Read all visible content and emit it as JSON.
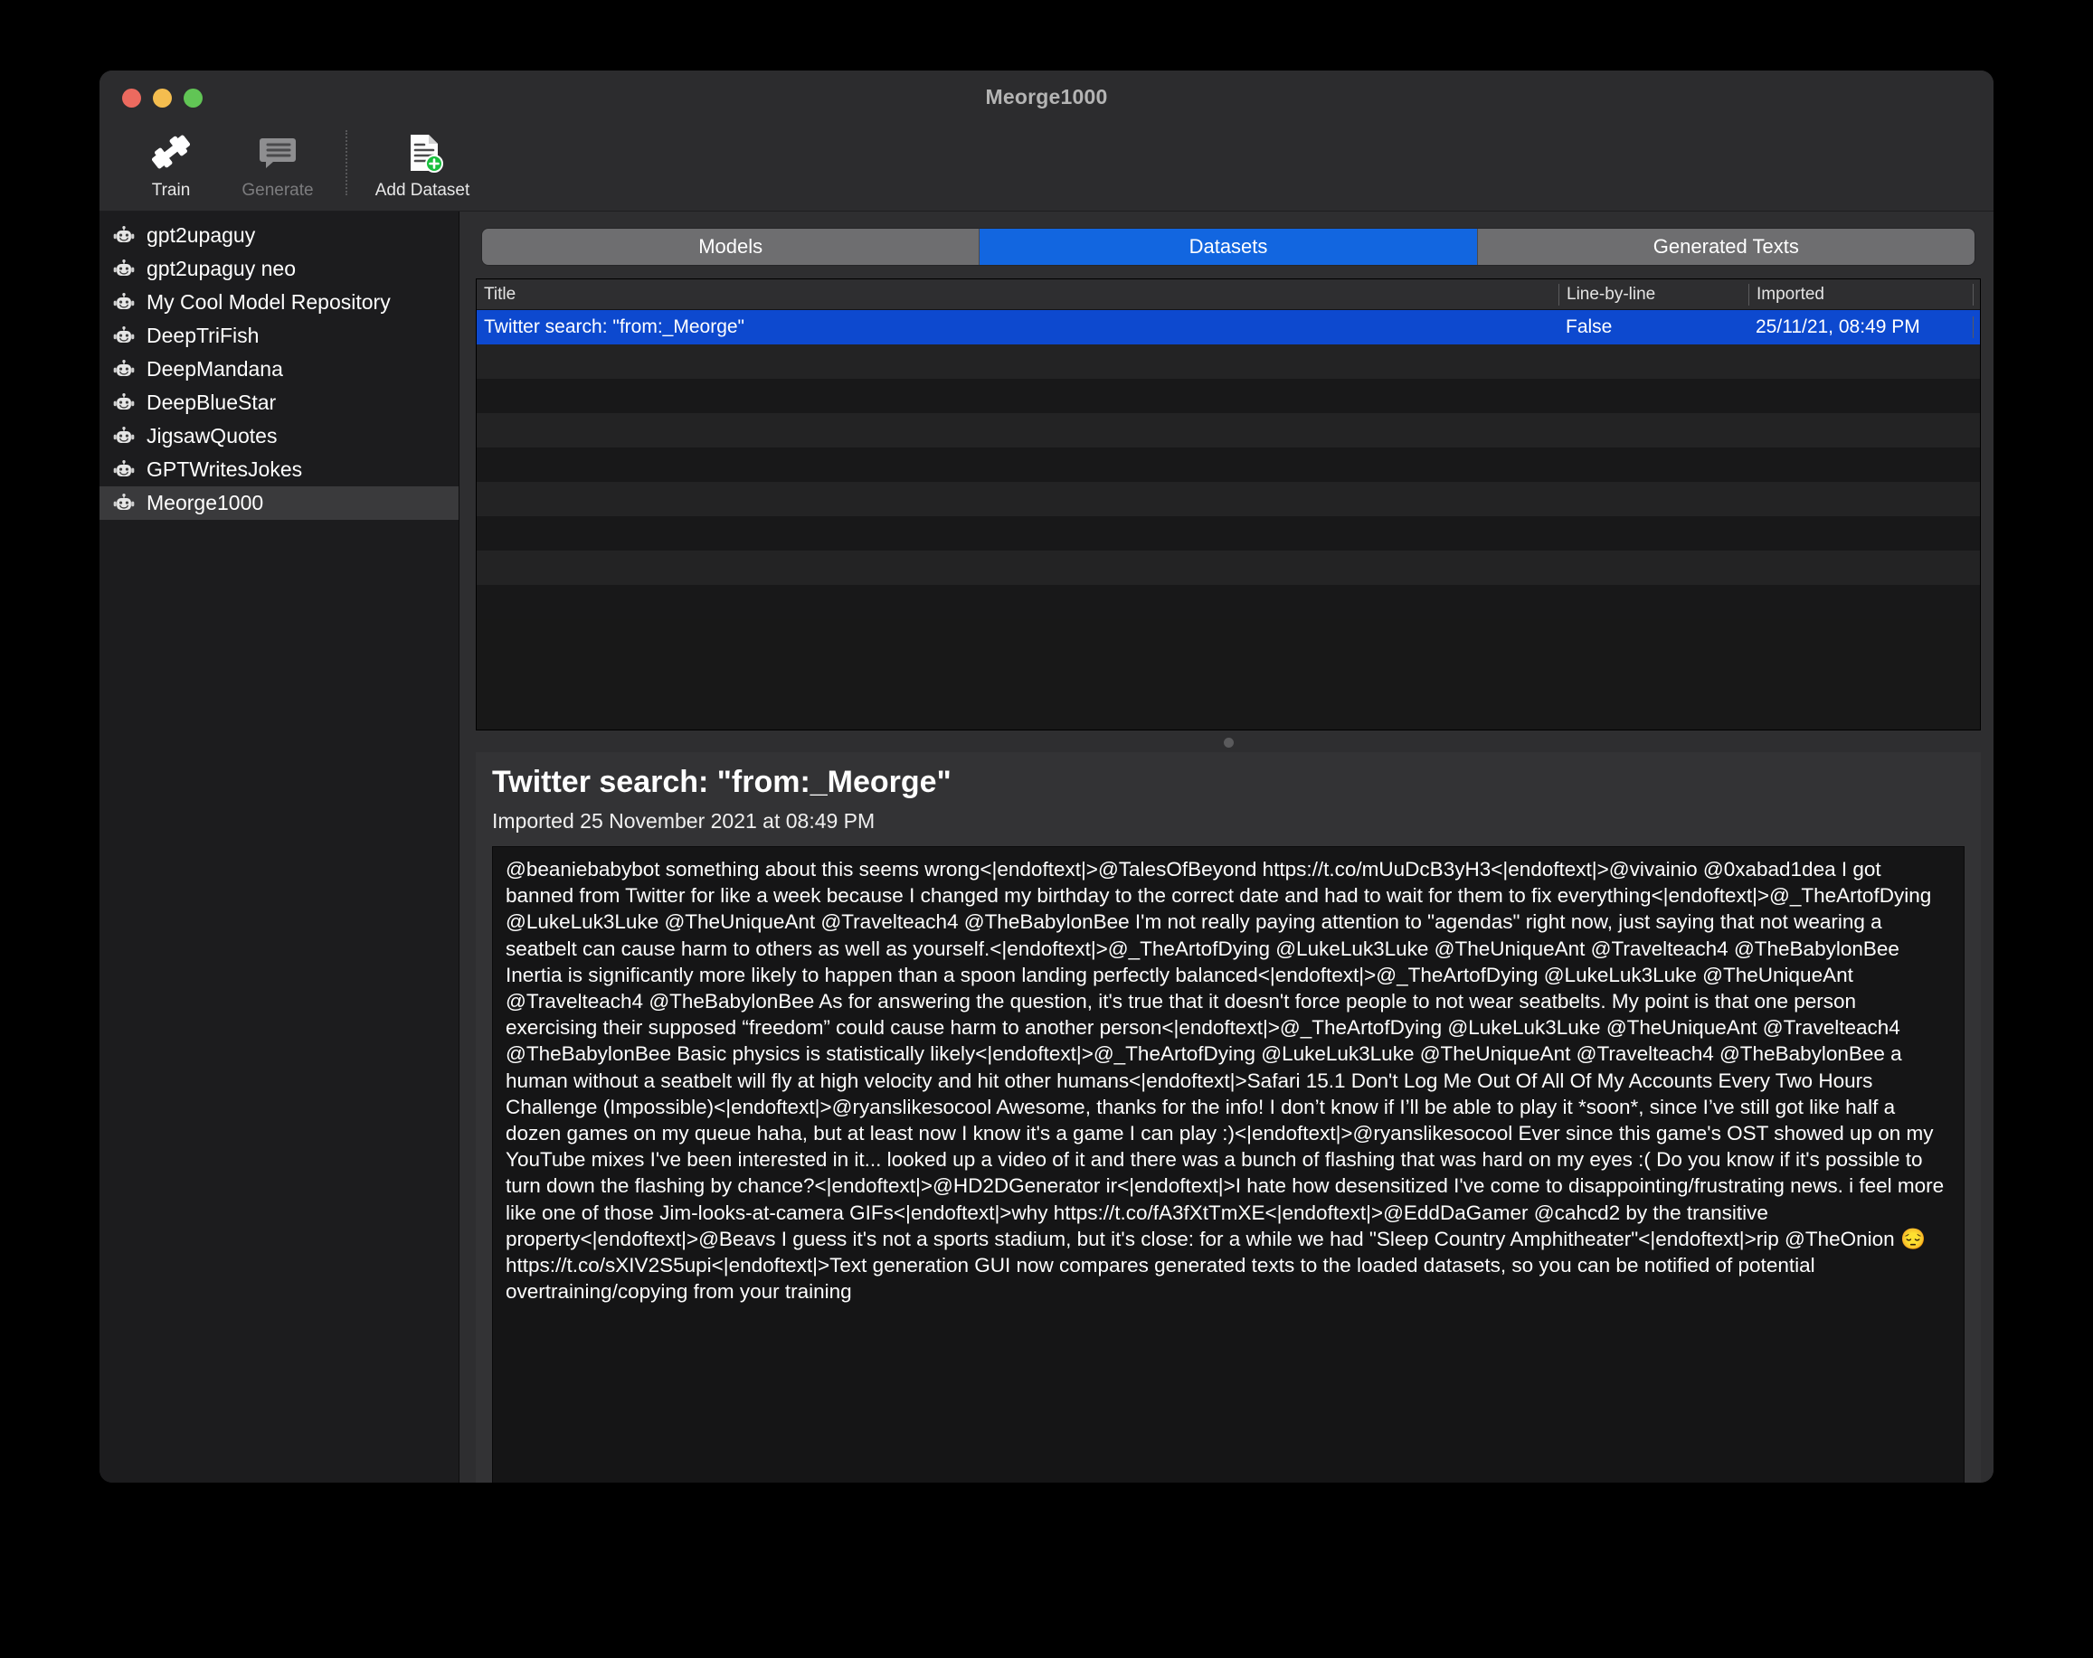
{
  "window": {
    "title": "Meorge1000",
    "traffic_lights": [
      "close-button",
      "minimize-button",
      "zoom-button"
    ]
  },
  "toolbar": {
    "items": [
      {
        "label": "Train",
        "icon": "dumbbell-icon",
        "enabled": true,
        "name": "train-button"
      },
      {
        "label": "Generate",
        "icon": "speech-bubble-icon",
        "enabled": false,
        "name": "generate-button"
      },
      {
        "label": "Add Dataset",
        "icon": "document-plus-icon",
        "enabled": true,
        "name": "add-dataset-button"
      }
    ]
  },
  "sidebar": {
    "items": [
      {
        "label": "gpt2upaguy",
        "icon": "robot-icon",
        "selected": false
      },
      {
        "label": "gpt2upaguy neo",
        "icon": "robot-icon",
        "selected": false
      },
      {
        "label": "My Cool Model Repository",
        "icon": "robot-icon",
        "selected": false
      },
      {
        "label": "DeepTriFish",
        "icon": "robot-icon",
        "selected": false
      },
      {
        "label": "DeepMandana",
        "icon": "robot-icon",
        "selected": false
      },
      {
        "label": "DeepBlueStar",
        "icon": "robot-icon",
        "selected": false
      },
      {
        "label": "JigsawQuotes",
        "icon": "robot-icon",
        "selected": false
      },
      {
        "label": "GPTWritesJokes",
        "icon": "robot-icon",
        "selected": false
      },
      {
        "label": "Meorge1000",
        "icon": "robot-icon",
        "selected": true
      }
    ]
  },
  "tabs": {
    "items": [
      {
        "label": "Models",
        "active": false
      },
      {
        "label": "Datasets",
        "active": true
      },
      {
        "label": "Generated Texts",
        "active": false
      }
    ]
  },
  "table": {
    "columns": [
      "Title",
      "Line-by-line",
      "Imported"
    ],
    "rows": [
      {
        "title": "Twitter search: \"from:_Meorge\"",
        "line_by_line": "False",
        "imported": "25/11/21, 08:49 PM",
        "selected": true
      }
    ],
    "empty_row_count": 8
  },
  "detail": {
    "title": "Twitter search: \"from:_Meorge\"",
    "subtitle": "Imported 25 November 2021 at 08:49 PM",
    "body": "@beaniebabybot something about this seems wrong<|endoftext|>@TalesOfBeyond https://t.co/mUuDcB3yH3<|endoftext|>@vivainio @0xabad1dea I got banned from Twitter for like a week because I changed my birthday to the correct date and had to wait for them to fix everything<|endoftext|>@_TheArtofDying @LukeLuk3Luke @TheUniqueAnt @Travelteach4 @TheBabylonBee I'm not really paying attention to \"agendas\" right now, just saying that not wearing a seatbelt can cause harm to others as well as yourself.<|endoftext|>@_TheArtofDying @LukeLuk3Luke @TheUniqueAnt @Travelteach4 @TheBabylonBee Inertia is significantly more likely to happen than a spoon landing perfectly balanced<|endoftext|>@_TheArtofDying @LukeLuk3Luke @TheUniqueAnt @Travelteach4 @TheBabylonBee As for answering the question, it's true that it doesn't force people to not wear seatbelts. My point is that one person exercising their supposed “freedom” could cause harm to another person<|endoftext|>@_TheArtofDying @LukeLuk3Luke @TheUniqueAnt @Travelteach4 @TheBabylonBee Basic physics is statistically likely<|endoftext|>@_TheArtofDying @LukeLuk3Luke @TheUniqueAnt @Travelteach4 @TheBabylonBee a human without a seatbelt will fly at high velocity and hit other humans<|endoftext|>Safari 15.1 Don't Log Me Out Of All Of My Accounts Every Two Hours Challenge (Impossible)<|endoftext|>@ryanslikesocool Awesome, thanks for the info! I don’t know if I’ll be able to play it *soon*, since I’ve still got like half a dozen games on my queue haha, but at least now I know it's a game I can play :)<|endoftext|>@ryanslikesocool Ever since this game's OST showed up on my YouTube mixes I've been interested in it... looked up a video of it and there was a bunch of flashing that was hard on my eyes :( Do you know if it's possible to turn down the flashing by chance?<|endoftext|>@HD2DGenerator ir<|endoftext|>I hate how desensitized I've come to disappointing/frustrating news. i feel more like one of those Jim-looks-at-camera GIFs<|endoftext|>why https://t.co/fA3fXtTmXE<|endoftext|>@EddDaGamer @cahcd2 by the transitive property<|endoftext|>@Beavs I guess it's not a sports stadium, but it's close: for a while we had \"Sleep Country Amphitheater\"<|endoftext|>rip @TheOnion 😔 https://t.co/sXIV2S5upi<|endoftext|>Text generation GUI now compares generated texts to the loaded datasets, so you can be notified of potential overtraining/copying from your training"
  },
  "colors": {
    "accent_blue": "#1266e0",
    "row_selected_blue": "#0d49cf",
    "window_bg": "#2c2c2e",
    "sidebar_bg": "#1c1c1e",
    "detail_bg": "#333335",
    "textbox_bg": "#151516"
  }
}
